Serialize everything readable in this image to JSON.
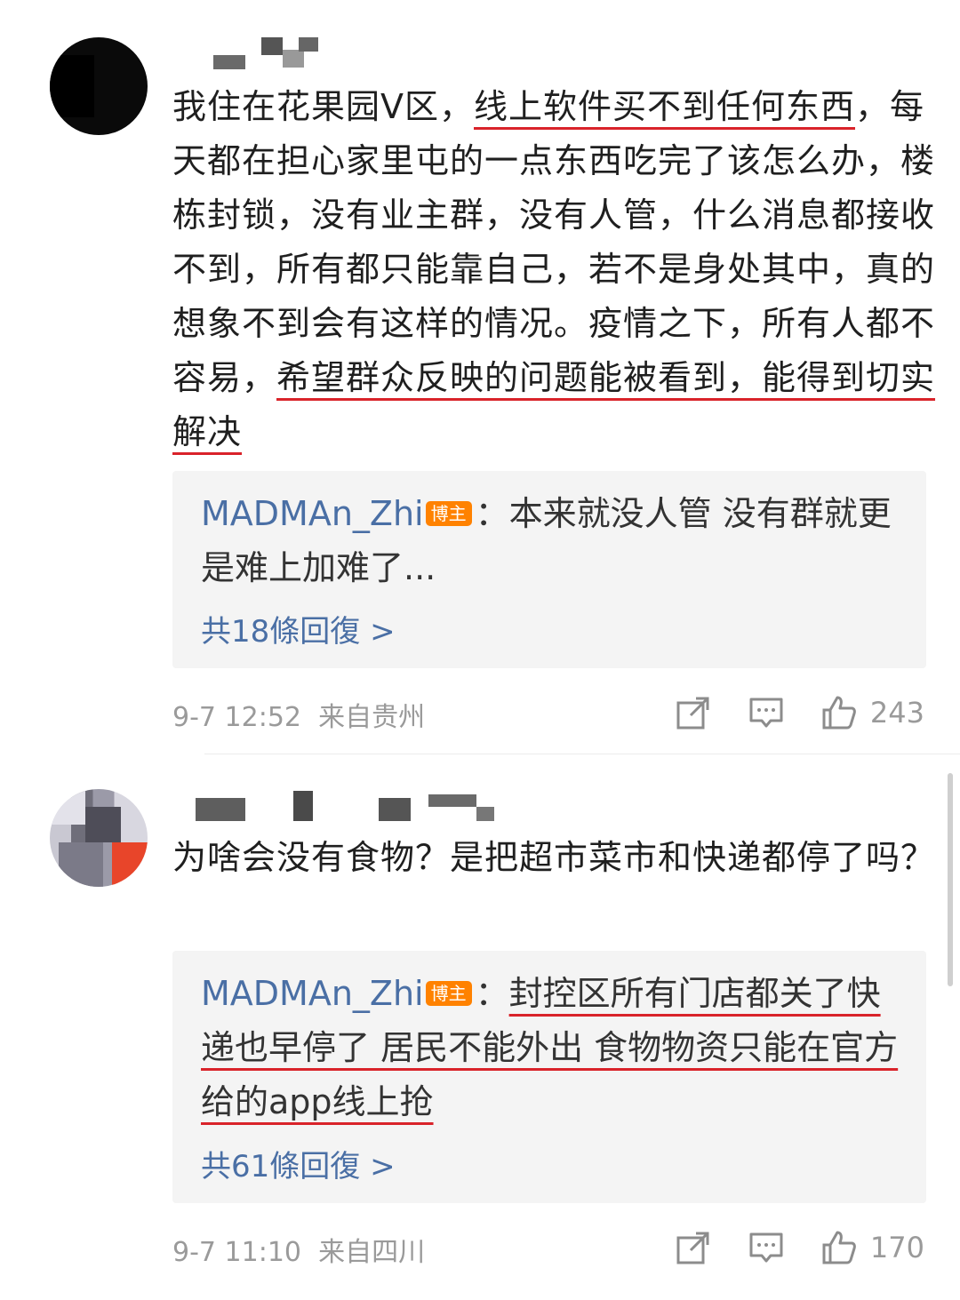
{
  "comments": [
    {
      "text_plain_1": "我住在花果园Ⅴ区，",
      "text_underlined_1": "线上软件买不到任何东西",
      "text_plain_2": "，每天都在担心家里屯的一点东西吃完了该怎么办，楼栋封锁，没有业主群，没有人管，什么消息都接收不到，所有都只能靠自己，若不是身处其中，真的想象不到会有这样的情况。疫情之下，所有人都不容易，",
      "text_underlined_2": "希望群众反映的问题能被看到，能得到切实解决",
      "reply": {
        "user": "MADMAn_Zhi",
        "badge": "博主",
        "separator": "：",
        "text": "本来就没人管 没有群就更是难上加难了...",
        "count_label": "共18條回復 >"
      },
      "time": "9-7 12:52",
      "location": "来自贵州",
      "likes": "243",
      "icons": [
        "share-icon",
        "comment-icon",
        "like-icon"
      ]
    },
    {
      "text_plain_1": "为啥会没有食物？是把超市菜市和快递都停了吗？",
      "reply": {
        "user": "MADMAn_Zhi",
        "badge": "博主",
        "separator": "：",
        "text_underlined": "封控区所有门店都关了快递也早停了 居民不能外出 食物物资只能在官方给的app线上抢",
        "count_label": "共61條回復 >"
      },
      "time": "9-7 11:10",
      "location": "来自四川",
      "likes": "170",
      "icons": [
        "share-icon",
        "comment-icon",
        "like-icon"
      ]
    }
  ],
  "colors": {
    "link_blue": "#4a6fa5",
    "badge_orange": "#ff8200",
    "underline_red": "#d9232a",
    "meta_gray": "#9a9a9a"
  }
}
